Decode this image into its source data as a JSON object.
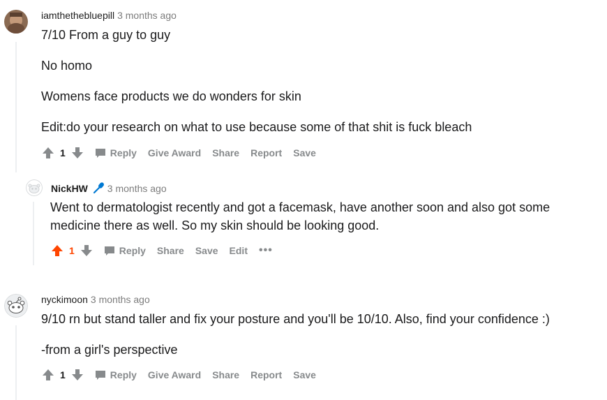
{
  "comments": [
    {
      "author": "iamthethebluepill",
      "time": "3 months ago",
      "paragraphs": [
        "7/10 From a guy to guy",
        "No homo",
        "Womens face products we do wonders for skin",
        "Edit:do your research on what to use because some of that shit is fuck bleach"
      ],
      "score": "1",
      "actions": {
        "reply": "Reply",
        "award": "Give Award",
        "share": "Share",
        "report": "Report",
        "save": "Save"
      }
    },
    {
      "author": "NickHW",
      "time": "3 months ago",
      "paragraphs": [
        "Went to dermatologist recently and got a facemask, have another soon and also got some medicine there as well. So my skin should be looking good."
      ],
      "score": "1",
      "actions": {
        "reply": "Reply",
        "share": "Share",
        "save": "Save",
        "edit": "Edit",
        "more": "•••"
      }
    },
    {
      "author": "nyckimoon",
      "time": "3 months ago",
      "paragraphs": [
        "9/10 rn but stand taller and fix your posture and you'll be 10/10. Also, find your confidence :)",
        "-from a girl's perspective"
      ],
      "score": "1",
      "actions": {
        "reply": "Reply",
        "award": "Give Award",
        "share": "Share",
        "report": "Report",
        "save": "Save"
      }
    }
  ],
  "colors": {
    "upvoted": "#ff4500",
    "action_gray": "#878a8c",
    "thread_line": "#edeff1",
    "mic_blue": "#0079d3"
  },
  "icons": {
    "upvote": "arrow-up-icon",
    "downvote": "arrow-down-icon",
    "reply": "speech-bubble-icon",
    "op_badge": "microphone-icon",
    "more": "ellipsis-icon"
  }
}
